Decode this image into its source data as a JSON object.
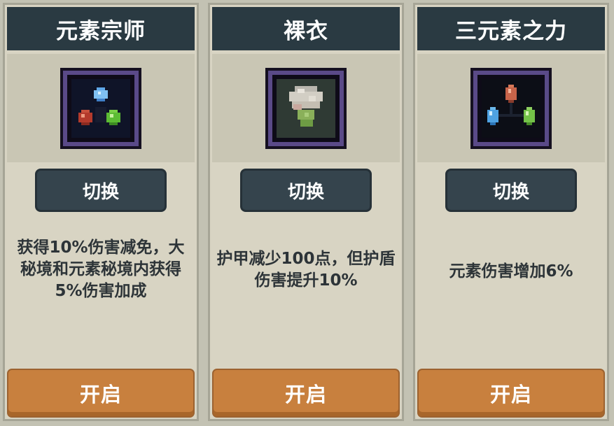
{
  "cards": [
    {
      "title": "元素宗师",
      "icon": "element-master-icon",
      "switch_label": "切换",
      "description": "获得10%伤害减免，大秘境和元素秘境内获得5%伤害加成",
      "open_label": "开启"
    },
    {
      "title": "裸衣",
      "icon": "bare-clothes-icon",
      "switch_label": "切换",
      "description": "护甲减少100点，但护盾伤害提升10%",
      "open_label": "开启"
    },
    {
      "title": "三元素之力",
      "icon": "three-elements-icon",
      "switch_label": "切换",
      "description": "元素伤害增加6%",
      "open_label": "开启"
    }
  ],
  "colors": {
    "background": "#c3c2b3",
    "card": "#d8d4c3",
    "header": "#2a3a42",
    "switch_button": "#35444d",
    "open_button": "#c8803e",
    "icon_frame": "#5a4a88"
  }
}
